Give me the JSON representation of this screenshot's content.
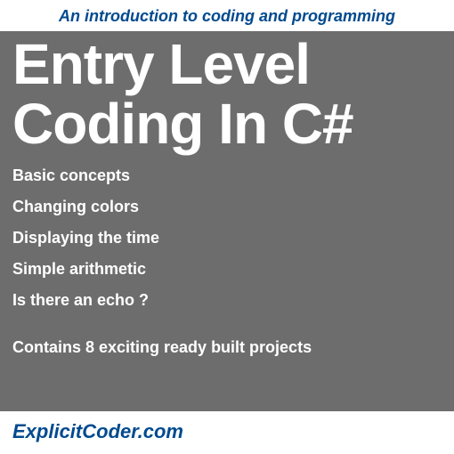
{
  "top_banner": "An introduction to coding and programming",
  "title": "Entry Level Coding In C#",
  "topics": [
    "Basic concepts",
    "Changing colors",
    "Displaying the time",
    "Simple arithmetic",
    "Is there an echo ?"
  ],
  "subtitle": "Contains 8 exciting ready built projects",
  "brand": "ExplicitCoder.com"
}
